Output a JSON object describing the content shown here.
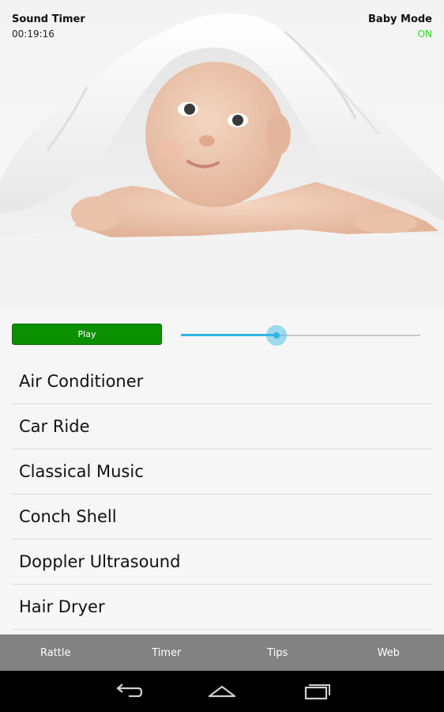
{
  "header": {
    "app_title": "Sound Timer",
    "timer_value": "00:19:16",
    "mode_label": "Baby Mode",
    "mode_value": "ON",
    "mode_color": "#22dd22"
  },
  "controls": {
    "play_label": "Play",
    "play_color": "#0a9000",
    "volume_fraction": 0.4
  },
  "sounds": [
    {
      "label": "Air Conditioner"
    },
    {
      "label": "Car Ride"
    },
    {
      "label": "Classical Music"
    },
    {
      "label": "Conch Shell"
    },
    {
      "label": "Doppler Ultrasound"
    },
    {
      "label": "Hair Dryer"
    }
  ],
  "tabs": [
    {
      "label": "Rattle"
    },
    {
      "label": "Timer"
    },
    {
      "label": "Tips"
    },
    {
      "label": "Web"
    }
  ],
  "system_nav": {
    "icons": [
      "back-icon",
      "home-icon",
      "recent-apps-icon"
    ]
  }
}
